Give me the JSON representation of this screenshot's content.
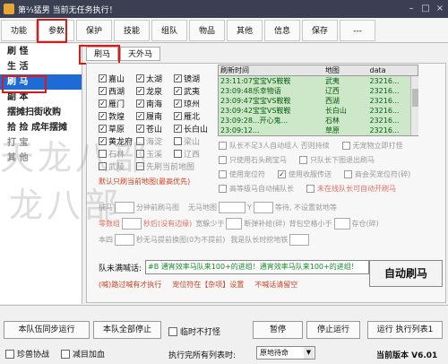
{
  "titlebar": {
    "title": "第⅔猛男  当前无任务执行！"
  },
  "menu": [
    "功能",
    "参数",
    "保护",
    "技能",
    "组队",
    "物品",
    "其他",
    "信息",
    "保存",
    "---"
  ],
  "nav": [
    {
      "label": "刷 怪"
    },
    {
      "label": "生 活"
    },
    {
      "label": "刷 马"
    },
    {
      "label": "副 本"
    },
    {
      "label": "摆摊扫街收购"
    },
    {
      "label": "拾 捡 成年摆摊"
    },
    {
      "label": "打 宝"
    },
    {
      "label": "其 他"
    }
  ],
  "subtabs": [
    "刷马",
    "天外马"
  ],
  "cb_rows": [
    [
      {
        "label": "嘉山",
        "checked": true
      },
      {
        "label": "太湖",
        "checked": true
      },
      {
        "label": "镜湖",
        "checked": true
      }
    ],
    [
      {
        "label": "西湖",
        "checked": true
      },
      {
        "label": "龙泉",
        "checked": true
      },
      {
        "label": "武夷",
        "checked": true
      }
    ],
    [
      {
        "label": "雁门",
        "checked": true
      },
      {
        "label": "南海",
        "checked": true
      },
      {
        "label": "琼州",
        "checked": true
      }
    ],
    [
      {
        "label": "敦煌",
        "checked": true
      },
      {
        "label": "履南",
        "checked": true
      },
      {
        "label": "雁北",
        "checked": true
      }
    ],
    [
      {
        "label": "草原",
        "checked": true
      },
      {
        "label": "苍山",
        "checked": true
      },
      {
        "label": "长白山",
        "checked": true
      }
    ],
    [
      {
        "label": "黄龙府",
        "checked": true
      },
      {
        "label": "海淀",
        "checked": false
      },
      {
        "label": "梁山",
        "checked": false
      }
    ],
    [
      {
        "label": "石林",
        "checked": false
      },
      {
        "label": "玉溪",
        "checked": false
      },
      {
        "label": "辽西",
        "checked": false
      }
    ],
    [
      {
        "label": "武陵",
        "checked": false
      },
      {
        "label": "先刷当前地图",
        "checked": false
      },
      {
        "label": "",
        "checked": false
      }
    ]
  ],
  "cb_hint": "默认只刷当前地图(最高优先)",
  "table": {
    "headers": [
      "刷新时间",
      "地图",
      "data"
    ],
    "rows": [
      [
        "23:11:07宝宝VS鞍鞍",
        "武夷",
        "23216..."
      ],
      [
        "23:09:48乐幸物语",
        "辽西",
        "23216..."
      ],
      [
        "23:09:47宝宝VS鞍鞍",
        "西湖",
        "23216..."
      ],
      [
        "23:09:42宝宝VS鞍鞍",
        "长白山",
        "23216..."
      ],
      [
        "23:09:28...开心鬼...",
        "石林",
        "23216..."
      ],
      [
        "23:09:12...",
        "草原",
        "23216..."
      ]
    ]
  },
  "options": [
    [
      "队长不足3人自动组人 否则持续",
      "无宠物立即打怪"
    ],
    [
      "只使用石头刷宝马",
      "只队长下图退出刷马"
    ],
    [
      "使用宠位符",
      "使用收服传送",
      "商会买宠位符(碎)"
    ],
    [
      "高等级马自动捕队长",
      "未在线队长可自动开刷马"
    ]
  ],
  "num_rows": [
    {
      "label": "捕马",
      "unit": "分钟前刷马图",
      "label2": "无马地图",
      "v2": "Y",
      "tail": "等待, 不设置就地等"
    },
    {
      "label": "零数组",
      "unit": "秒后(没有边缘)"
    },
    {
      "label": "本四",
      "unit": "秒无马提前换图(0为不提前)",
      "tail": "我是队长时挖地铁"
    }
  ],
  "extra_line": {
    "a": "宽躲少于",
    "b": "断弹补给(碎)",
    "c": "背包空格小于",
    "d": "存仓(碎)"
  },
  "message": {
    "label": "队未满喊话:",
    "value": "#B 通宵效率马队来100+的进组！通宵效率马队来100+的进组！"
  },
  "links": [
    "(喊)路过喊有才执行",
    "宠位符在【杂项】设置",
    "不喊话请留空"
  ],
  "auto_btn": "自动刷马",
  "bottom": {
    "sync": "本队伍同步运行",
    "stop_all": "本队全部停止",
    "temp_no_fight": "临时不打怪",
    "pause": "暂停",
    "stop": "停止运行",
    "run_list": "运行 执行列表1",
    "pearl": "珍兽协战",
    "reduce_hp": "减目加血",
    "after_list": "执行完所有列表时:",
    "after_value": "原地待命",
    "version": "当前版本 V6.01"
  },
  "watermark": [
    "天龙八部",
    "龙八部"
  ]
}
